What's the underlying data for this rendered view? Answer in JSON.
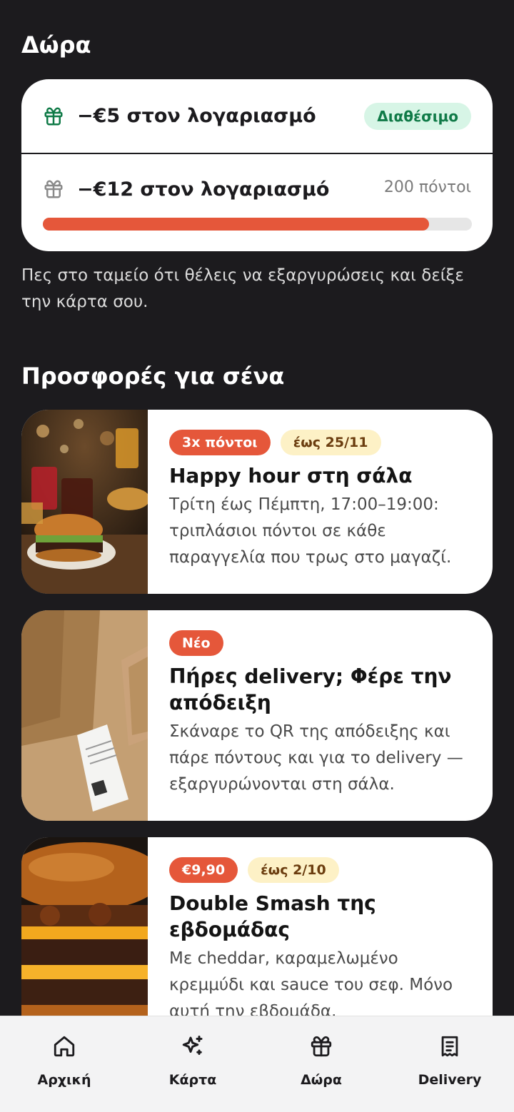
{
  "gifts": {
    "title": "Δώρα",
    "items": [
      {
        "title": "−€5 στον λογαριασμό",
        "badge": "Διαθέσιμο"
      },
      {
        "title": "−€12 στον λογαριασμό",
        "points": "200 πόντοι",
        "progress": 0.9
      }
    ],
    "hint": "Πες στο ταμείο ότι θέλεις να εξαργυρώσεις και δείξε την κάρτα σου."
  },
  "offers": {
    "title": "Προσφορές για σένα",
    "items": [
      {
        "chips": [
          "3x πόντοι",
          "έως 25/11"
        ],
        "title": "Happy hour στη σάλα",
        "description": "Τρίτη έως Πέμπτη, 17:00–19:00: τριπλάσιοι πόντοι σε κάθε παραγγελία που τρως στο μαγαζί."
      },
      {
        "chips": [
          "Νέο"
        ],
        "title": "Πήρες delivery; Φέρε την απόδειξη",
        "description": "Σκάναρε το QR της απόδειξης και πάρε πόντους και για το delivery — εξαργυρώνονται στη σάλα."
      },
      {
        "chips": [
          "€9,90",
          "έως 2/10"
        ],
        "title": "Double Smash της εβδομάδας",
        "description": "Με cheddar, καραμελωμένο κρεμμύδι και sauce του σεφ. Μόνο αυτή την εβδομάδα."
      }
    ]
  },
  "nav": {
    "items": [
      {
        "label": "Αρχική",
        "icon": "home-icon"
      },
      {
        "label": "Κάρτα",
        "icon": "sparkle-icon"
      },
      {
        "label": "Δώρα",
        "icon": "gift-icon"
      },
      {
        "label": "Delivery",
        "icon": "receipt-icon"
      }
    ]
  },
  "colors": {
    "background": "#1c1b1e",
    "accent": "#e5573a",
    "available": "#0f7a47"
  }
}
